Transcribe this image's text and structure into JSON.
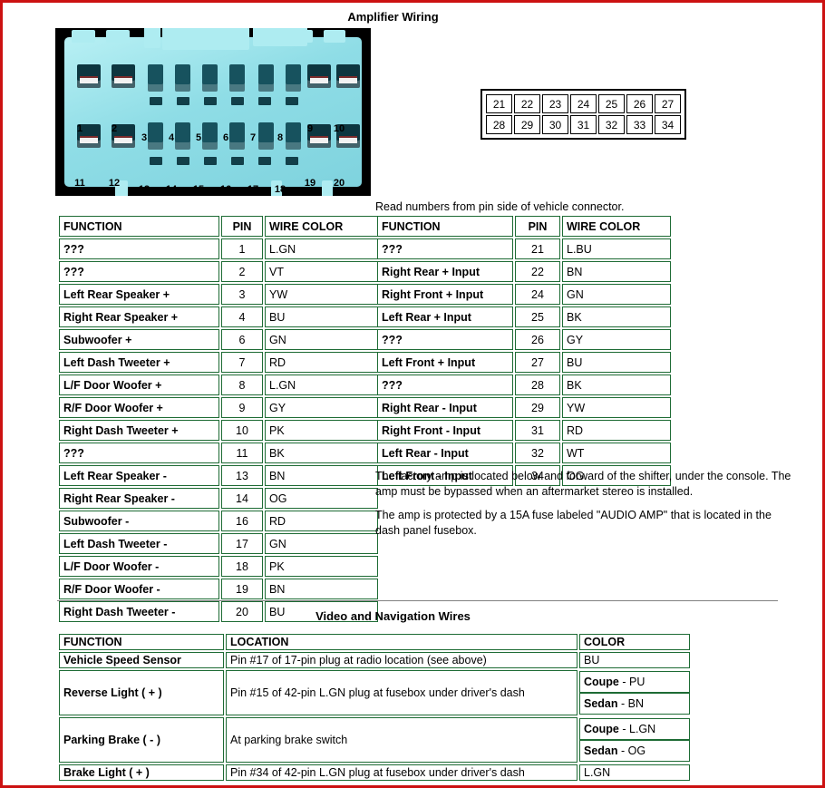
{
  "page": {
    "frame_color": "#cc1111",
    "table_border_color": "#1d6b34"
  },
  "amplifier_section": {
    "title": "Amplifier Wiring",
    "read_note": "Read numbers from pin side of vehicle connector.",
    "note_1": "The factory amp is located below and forward of the shifter, under the console. The amp must be bypassed when an aftermarket stereo is installed.",
    "note_2": "The amp is protected by a 15A fuse labeled \"AUDIO AMP\" that is located in the dash panel fusebox.",
    "connector_photo": {
      "name": "vehicle-connector-photo",
      "background": "#000000",
      "body_color": "#9fe8ee",
      "top_row_pins": [
        "1",
        "2",
        "3",
        "4",
        "5",
        "6",
        "7",
        "8",
        "9",
        "10"
      ],
      "bottom_row_pins": [
        "11",
        "12",
        "13",
        "14",
        "15",
        "16",
        "17",
        "18",
        "19",
        "20"
      ]
    },
    "pin_grid": {
      "top_row": [
        "21",
        "22",
        "23",
        "24",
        "25",
        "26",
        "27"
      ],
      "bottom_row": [
        "28",
        "29",
        "30",
        "31",
        "32",
        "33",
        "34"
      ]
    },
    "left_table": {
      "headers": [
        "FUNCTION",
        "PIN",
        "WIRE COLOR"
      ],
      "rows": [
        {
          "function": "???",
          "pin": "1",
          "color": "L.GN"
        },
        {
          "function": "???",
          "pin": "2",
          "color": "VT"
        },
        {
          "function": "Left Rear Speaker +",
          "pin": "3",
          "color": "YW"
        },
        {
          "function": "Right Rear Speaker +",
          "pin": "4",
          "color": "BU"
        },
        {
          "function": "Subwoofer +",
          "pin": "6",
          "color": "GN"
        },
        {
          "function": "Left Dash Tweeter +",
          "pin": "7",
          "color": "RD"
        },
        {
          "function": "L/F Door Woofer +",
          "pin": "8",
          "color": "L.GN"
        },
        {
          "function": "R/F Door Woofer +",
          "pin": "9",
          "color": "GY"
        },
        {
          "function": "Right Dash Tweeter +",
          "pin": "10",
          "color": "PK"
        },
        {
          "function": "???",
          "pin": "11",
          "color": "BK"
        },
        {
          "function": "Left Rear Speaker -",
          "pin": "13",
          "color": "BN"
        },
        {
          "function": "Right Rear Speaker -",
          "pin": "14",
          "color": "OG"
        },
        {
          "function": "Subwoofer -",
          "pin": "16",
          "color": "RD"
        },
        {
          "function": "Left Dash Tweeter -",
          "pin": "17",
          "color": "GN"
        },
        {
          "function": "L/F Door Woofer -",
          "pin": "18",
          "color": "PK"
        },
        {
          "function": "R/F Door Woofer -",
          "pin": "19",
          "color": "BN"
        },
        {
          "function": "Right Dash Tweeter -",
          "pin": "20",
          "color": "BU"
        }
      ]
    },
    "right_table": {
      "headers": [
        "FUNCTION",
        "PIN",
        "WIRE COLOR"
      ],
      "rows": [
        {
          "function": "???",
          "pin": "21",
          "color": "L.BU"
        },
        {
          "function": "Right Rear + Input",
          "pin": "22",
          "color": "BN"
        },
        {
          "function": "Right Front + Input",
          "pin": "24",
          "color": "GN"
        },
        {
          "function": "Left Rear + Input",
          "pin": "25",
          "color": "BK"
        },
        {
          "function": "???",
          "pin": "26",
          "color": "GY"
        },
        {
          "function": "Left Front + Input",
          "pin": "27",
          "color": "BU"
        },
        {
          "function": "???",
          "pin": "28",
          "color": "BK"
        },
        {
          "function": "Right Rear - Input",
          "pin": "29",
          "color": "YW"
        },
        {
          "function": "Right Front - Input",
          "pin": "31",
          "color": "RD"
        },
        {
          "function": "Left Rear - Input",
          "pin": "32",
          "color": "WT"
        },
        {
          "function": "Left Front - Input",
          "pin": "34",
          "color": "OG"
        }
      ]
    }
  },
  "video_section": {
    "title": "Video and Navigation Wires",
    "headers": [
      "FUNCTION",
      "LOCATION",
      "COLOR"
    ],
    "rows": [
      {
        "function": "Vehicle Speed Sensor",
        "location": "Pin #17 of 17-pin plug at radio location (see above)",
        "colors": [
          {
            "variant": "",
            "value": "BU"
          }
        ]
      },
      {
        "function": "Reverse Light ( + )",
        "location": "Pin #15 of 42-pin L.GN plug at fusebox under driver's dash",
        "colors": [
          {
            "variant": "Coupe",
            "value": "- PU"
          },
          {
            "variant": "Sedan",
            "value": "- BN"
          }
        ]
      },
      {
        "function": "Parking Brake ( - )",
        "location": "At parking brake switch",
        "colors": [
          {
            "variant": "Coupe",
            "value": "- L.GN"
          },
          {
            "variant": "Sedan",
            "value": "- OG"
          }
        ]
      },
      {
        "function": "Brake Light ( + )",
        "location": "Pin #34 of 42-pin L.GN plug at fusebox under driver's dash",
        "colors": [
          {
            "variant": "",
            "value": "L.GN"
          }
        ]
      }
    ]
  }
}
